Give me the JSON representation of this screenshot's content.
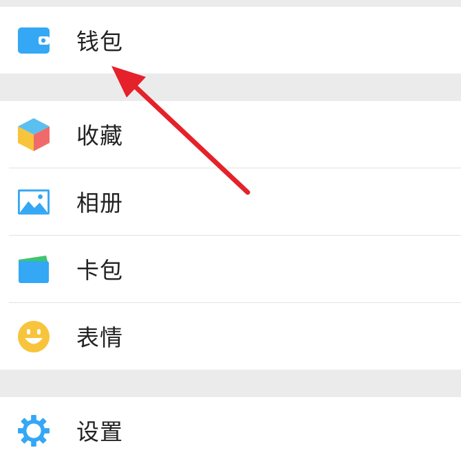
{
  "menu": {
    "wallet": {
      "label": "钱包",
      "icon": "wallet-icon"
    },
    "favorites": {
      "label": "收藏",
      "icon": "cube-icon"
    },
    "album": {
      "label": "相册",
      "icon": "image-icon"
    },
    "cards": {
      "label": "卡包",
      "icon": "card-icon"
    },
    "stickers": {
      "label": "表情",
      "icon": "smiley-icon"
    },
    "settings": {
      "label": "设置",
      "icon": "gear-icon"
    }
  },
  "colors": {
    "icon_blue": "#34a7f5",
    "icon_yellow": "#f8c43c",
    "cube_red": "#f06a6a",
    "card_green": "#3fc56c",
    "arrow_red": "#e5212a",
    "divider": "#e2e2e2",
    "gap": "#ebebeb"
  }
}
